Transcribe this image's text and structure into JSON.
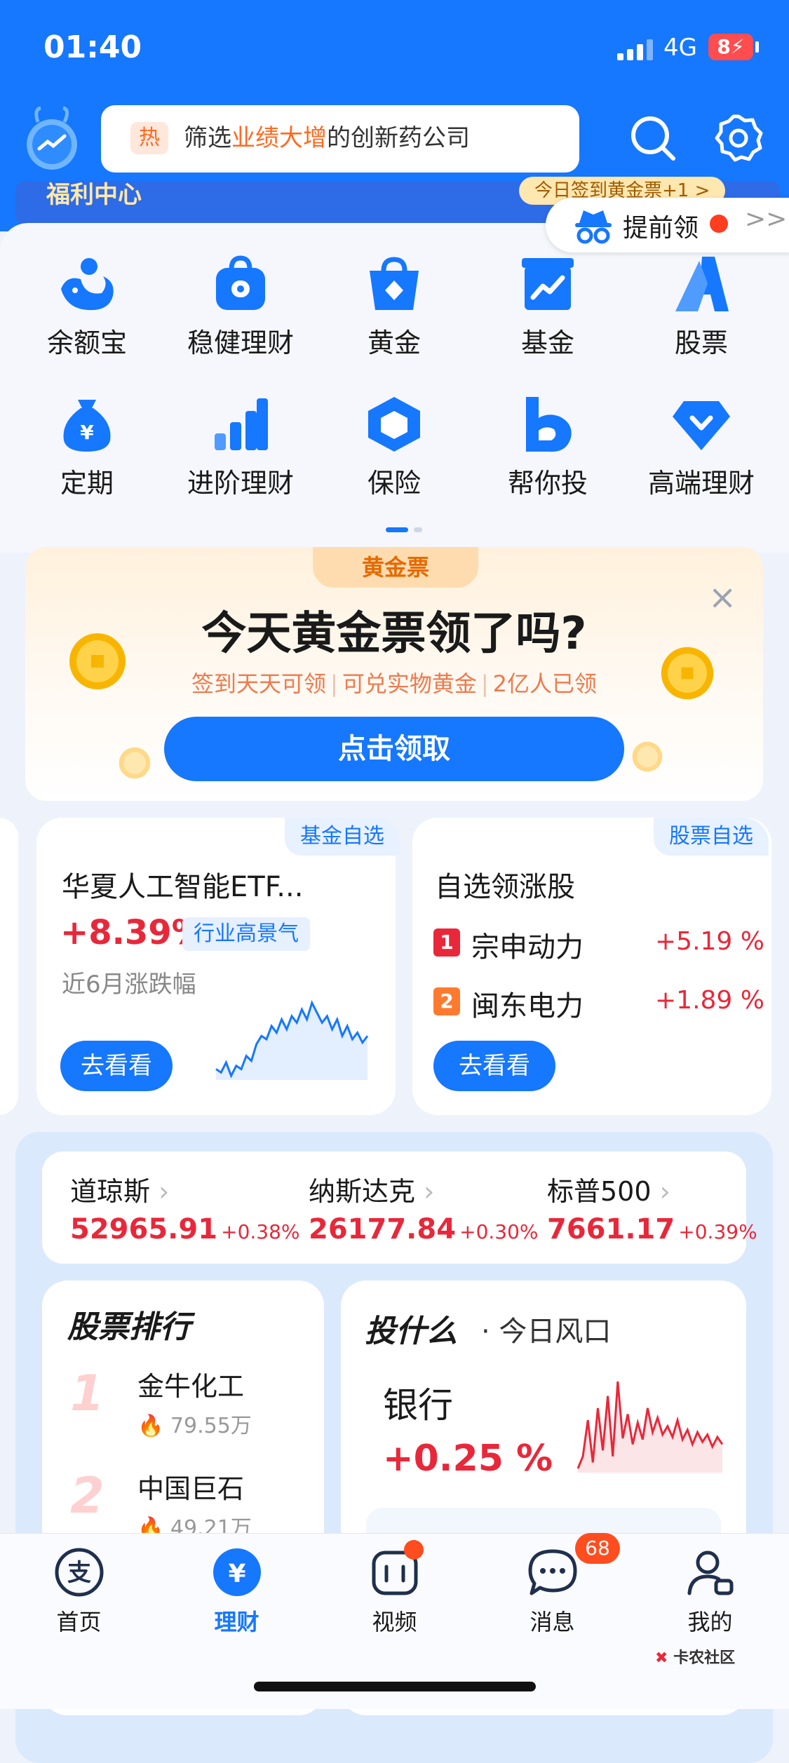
{
  "status": {
    "time": "01:40",
    "network": "4G",
    "battery": "8"
  },
  "search": {
    "hot_tag": "热",
    "prefix": "筛选",
    "highlight": "业绩大增",
    "suffix": "的创新药公司"
  },
  "strip": {
    "left": "福利中心",
    "right": "今日签到黄金票+1 >"
  },
  "advance": {
    "label": "提前领",
    "arrows": ">>"
  },
  "grid": [
    {
      "label": "余额宝",
      "icon": "yuebao-icon"
    },
    {
      "label": "稳健理财",
      "icon": "wallet-icon"
    },
    {
      "label": "黄金",
      "icon": "gold-icon"
    },
    {
      "label": "基金",
      "icon": "fund-icon"
    },
    {
      "label": "股票",
      "icon": "stock-icon"
    },
    {
      "label": "定期",
      "icon": "money-bag-icon"
    },
    {
      "label": "进阶理财",
      "icon": "bar-chart-icon"
    },
    {
      "label": "保险",
      "icon": "insurance-icon"
    },
    {
      "label": "帮你投",
      "icon": "invest-helper-icon"
    },
    {
      "label": "高端理财",
      "icon": "diamond-icon"
    }
  ],
  "banner": {
    "tag": "黄金票",
    "title": "今天黄金票领了吗?",
    "sub": [
      "签到天天可领",
      "可兑实物黄金",
      "2亿人已领"
    ],
    "sep": "|",
    "button": "点击领取",
    "close": "×"
  },
  "fund_card": {
    "tag": "基金自选",
    "name": "华夏人工智能ETF...",
    "pct": "+8.39%",
    "pill": "行业高景气",
    "sub": "近6月涨跌幅",
    "button": "去看看",
    "sparkline": [
      40,
      38,
      44,
      36,
      42,
      40,
      48,
      45,
      55,
      60,
      58,
      66,
      62,
      70,
      64,
      72,
      68,
      76,
      70,
      80,
      74,
      68,
      72,
      64,
      70,
      60,
      66,
      58,
      62,
      56,
      60
    ],
    "color": "#1677ff"
  },
  "stock_card": {
    "tag": "股票自选",
    "title": "自选领涨股",
    "items": [
      {
        "rank": "1",
        "name": "宗申动力",
        "pct": "+5.19 %"
      },
      {
        "rank": "2",
        "name": "闽东电力",
        "pct": "+1.89 %"
      }
    ],
    "button": "去看看"
  },
  "indices": [
    {
      "name": "道琼斯",
      "value": "52965.91",
      "change": "+0.38%"
    },
    {
      "name": "纳斯达克",
      "value": "26177.84",
      "change": "+0.30%"
    },
    {
      "name": "标普500",
      "value": "7661.17",
      "change": "+0.39%"
    }
  ],
  "ranking": {
    "title": "股票排行",
    "items": [
      {
        "rank": "1",
        "name": "金牛化工",
        "heat": "79.55万"
      },
      {
        "rank": "2",
        "name": "中国巨石",
        "heat": "49.21万"
      }
    ]
  },
  "invest": {
    "title": "投什么",
    "sub": "· 今日风口",
    "sector": "银行",
    "pct": "+0.25 %",
    "sparkline": [
      20,
      30,
      60,
      25,
      70,
      35,
      80,
      30,
      92,
      45,
      65,
      40,
      58,
      44,
      70,
      50,
      62,
      48,
      55,
      46,
      60,
      44,
      52,
      40,
      50,
      42,
      48,
      38,
      46,
      40
    ],
    "color": "#e8283a"
  },
  "tabs": [
    {
      "label": "首页",
      "icon": "alipay-home-icon",
      "active": false
    },
    {
      "label": "理财",
      "icon": "yuan-icon",
      "active": true
    },
    {
      "label": "视频",
      "icon": "video-icon",
      "active": false
    },
    {
      "label": "消息",
      "icon": "message-icon",
      "active": false,
      "badge": "68"
    },
    {
      "label": "我的",
      "icon": "profile-icon",
      "active": false
    }
  ],
  "watermark": "卡农社区"
}
